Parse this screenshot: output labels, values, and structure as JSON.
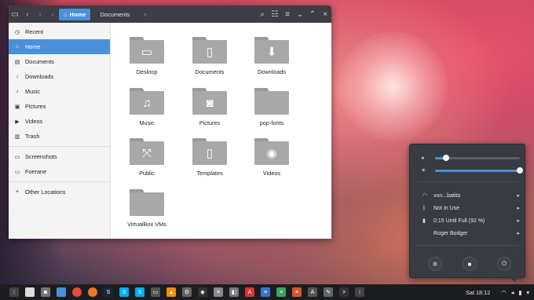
{
  "window": {
    "path": {
      "home_label": "Home",
      "current_label": "Documents"
    },
    "icons": {
      "app": "folder-icon",
      "back": "back-icon",
      "forward": "forward-icon",
      "search": "search-icon",
      "view": "list-view-icon",
      "menu": "menu-icon",
      "minimize": "minimize-icon",
      "maximize": "maximize-icon",
      "close": "close-icon"
    }
  },
  "sidebar": {
    "places": [
      {
        "label": "Recent",
        "icon": "clock-icon",
        "glyph": "◷"
      },
      {
        "label": "Home",
        "icon": "home-icon",
        "glyph": "⌂",
        "active": true
      },
      {
        "label": "Documents",
        "icon": "document-icon",
        "glyph": "▤"
      },
      {
        "label": "Downloads",
        "icon": "download-icon",
        "glyph": "↓"
      },
      {
        "label": "Music",
        "icon": "music-icon",
        "glyph": "♪"
      },
      {
        "label": "Pictures",
        "icon": "pictures-icon",
        "glyph": "▣"
      },
      {
        "label": "Videos",
        "icon": "videos-icon",
        "glyph": "▶"
      },
      {
        "label": "Trash",
        "icon": "trash-icon",
        "glyph": "▥"
      }
    ],
    "devices": [
      {
        "label": "Screenshots",
        "icon": "drive-icon",
        "glyph": "▭"
      },
      {
        "label": "Foerane",
        "icon": "drive-icon",
        "glyph": "▭"
      }
    ],
    "other": {
      "label": "Other Locations",
      "icon": "plus-icon",
      "glyph": "+"
    }
  },
  "files": [
    {
      "label": "Desktop",
      "icon": "desktop-folder-icon",
      "glyph": "▭"
    },
    {
      "label": "Documents",
      "icon": "documents-folder-icon",
      "glyph": "▯"
    },
    {
      "label": "Downloads",
      "icon": "downloads-folder-icon",
      "glyph": "⬇"
    },
    {
      "label": "Music",
      "icon": "music-folder-icon",
      "glyph": "♫"
    },
    {
      "label": "Pictures",
      "icon": "pictures-folder-icon",
      "glyph": "◙"
    },
    {
      "label": "pop-fonts",
      "icon": "folder-icon",
      "glyph": ""
    },
    {
      "label": "Public",
      "icon": "public-folder-icon",
      "glyph": "⤧"
    },
    {
      "label": "Templates",
      "icon": "templates-folder-icon",
      "glyph": "▯"
    },
    {
      "label": "Videos",
      "icon": "videos-folder-icon",
      "glyph": "◉"
    },
    {
      "label": "VirtualBox VMs",
      "icon": "folder-icon",
      "glyph": ""
    }
  ],
  "system_menu": {
    "volume": {
      "icon": "volume-icon",
      "level": 0.13
    },
    "brightness": {
      "icon": "brightness-icon",
      "level": 1.0
    },
    "items": [
      {
        "label": "von...batito",
        "icon": "wifi-icon",
        "glyph": "◠"
      },
      {
        "label": "Not In Use",
        "icon": "bluetooth-icon",
        "glyph": "ᛒ"
      },
      {
        "label": "0:15 Until Full (92 %)",
        "icon": "battery-icon",
        "glyph": "▮"
      },
      {
        "label": "Roger Bodger",
        "icon": "user-avatar-icon",
        "glyph": ""
      }
    ],
    "actions": [
      {
        "name": "settings-button",
        "icon": "settings-icon",
        "glyph": "✲"
      },
      {
        "name": "lock-button",
        "icon": "lock-icon",
        "glyph": "■"
      },
      {
        "name": "power-button",
        "icon": "power-icon",
        "glyph": "⏻"
      }
    ]
  },
  "taskbar": {
    "apps": [
      {
        "icon": "app-show-apps-icon",
        "color": "#444",
        "glyph": "⋮"
      },
      {
        "icon": "app-file-icon",
        "color": "#ddd",
        "glyph": ""
      },
      {
        "icon": "app-camera-icon",
        "color": "#777",
        "glyph": "◙"
      },
      {
        "icon": "app-files-icon",
        "color": "#4a90d9",
        "glyph": ""
      },
      {
        "icon": "app-chrome-icon",
        "color": "#e94b3c",
        "glyph": ""
      },
      {
        "icon": "app-firefox-icon",
        "color": "#e8782a",
        "glyph": ""
      },
      {
        "icon": "app-steam-icon",
        "color": "#1b2838",
        "glyph": "S"
      },
      {
        "icon": "app-skype-icon",
        "color": "#00aff0",
        "glyph": "S"
      },
      {
        "icon": "app-skype-alt-icon",
        "color": "#00aff0",
        "glyph": "S"
      },
      {
        "icon": "app-monitor-icon",
        "color": "#555",
        "glyph": "▭"
      },
      {
        "icon": "app-vlc-icon",
        "color": "#f28c0f",
        "glyph": "▲"
      },
      {
        "icon": "app-settings-icon",
        "color": "#666",
        "glyph": "⚙"
      },
      {
        "icon": "app-inkscape-icon",
        "color": "#333",
        "glyph": "◆"
      },
      {
        "icon": "app-tools-icon",
        "color": "#888",
        "glyph": "✕"
      },
      {
        "icon": "app-eraser-icon",
        "color": "#777",
        "glyph": "◧"
      },
      {
        "icon": "app-pdf-icon",
        "color": "#d33",
        "glyph": "A"
      },
      {
        "icon": "app-writer-icon",
        "color": "#3a77c9",
        "glyph": "≡"
      },
      {
        "icon": "app-calc-icon",
        "color": "#3aa55a",
        "glyph": "≡"
      },
      {
        "icon": "app-impress-icon",
        "color": "#d8582b",
        "glyph": "≡"
      },
      {
        "icon": "app-font-icon",
        "color": "#555",
        "glyph": "A"
      },
      {
        "icon": "app-extension-icon",
        "color": "#666",
        "glyph": "✎"
      },
      {
        "icon": "app-terminal-icon",
        "color": "#333",
        "glyph": ">"
      },
      {
        "icon": "app-grid-icon",
        "color": "#444",
        "glyph": "⁝"
      }
    ],
    "clock": "Sat 18:12",
    "tray": [
      {
        "icon": "wifi-tray-icon",
        "glyph": "◠"
      },
      {
        "icon": "volume-tray-icon",
        "glyph": "◂"
      },
      {
        "icon": "battery-tray-icon",
        "glyph": "▮"
      },
      {
        "icon": "tray-menu-chevron-icon",
        "glyph": "▾"
      }
    ]
  }
}
